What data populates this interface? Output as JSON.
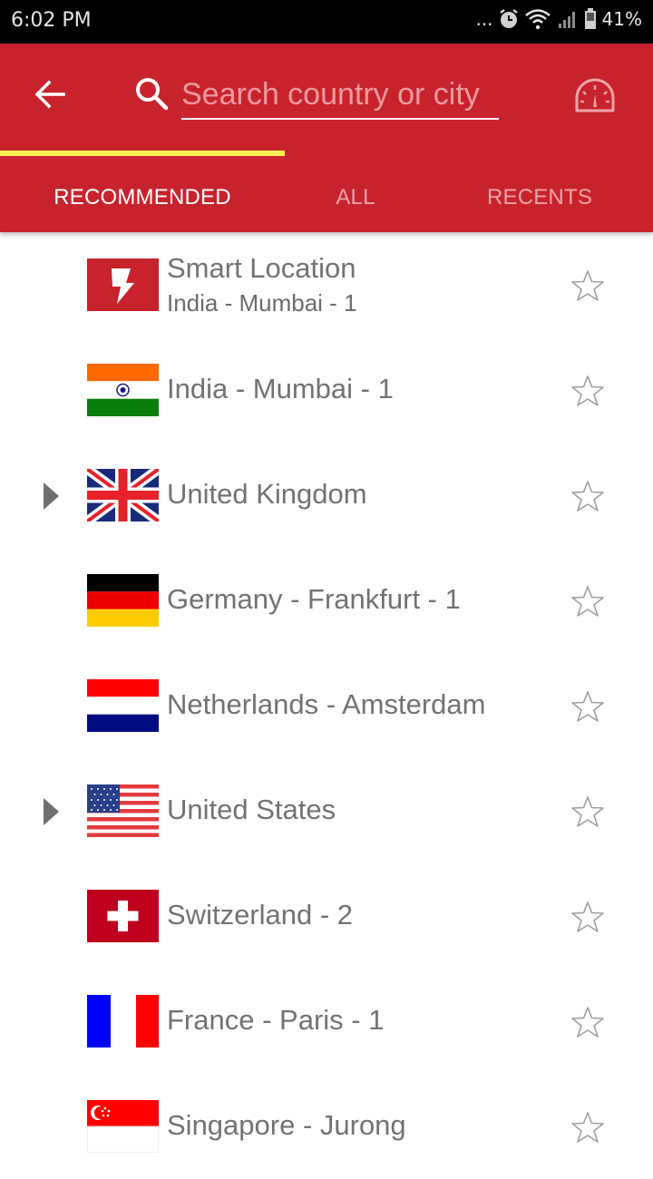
{
  "status_bar": {
    "time": "6:02 PM",
    "overflow": "...",
    "battery": "41%",
    "icons": [
      "alarm-icon",
      "wifi-icon",
      "signal-icon",
      "battery-icon"
    ]
  },
  "app_bar": {
    "back_icon": "arrow-left-icon",
    "search_icon": "search-icon",
    "search_value": "",
    "search_placeholder": "Search country or city",
    "speed_test_icon": "speedometer-icon",
    "background": "#c8232c",
    "tab_indicator_color": "#fff154"
  },
  "tabs": [
    {
      "label": "RECOMMENDED",
      "active": true
    },
    {
      "label": "ALL",
      "active": false
    },
    {
      "label": "RECENTS",
      "active": false
    }
  ],
  "locations": [
    {
      "name": "Smart Location",
      "subtitle": "India - Mumbai - 1",
      "flag": "smart-location",
      "expandable": false,
      "favorite": false
    },
    {
      "name": "India - Mumbai - 1",
      "flag": "india",
      "expandable": false,
      "favorite": false
    },
    {
      "name": "United Kingdom",
      "flag": "united-kingdom",
      "expandable": true,
      "favorite": false
    },
    {
      "name": "Germany - Frankfurt - 1",
      "flag": "germany",
      "expandable": false,
      "favorite": false
    },
    {
      "name": "Netherlands - Amsterdam",
      "flag": "netherlands",
      "expandable": false,
      "favorite": false
    },
    {
      "name": "United States",
      "flag": "united-states",
      "expandable": true,
      "favorite": false
    },
    {
      "name": "Switzerland - 2",
      "flag": "switzerland",
      "expandable": false,
      "favorite": false
    },
    {
      "name": "France - Paris - 1",
      "flag": "france",
      "expandable": false,
      "favorite": false
    },
    {
      "name": "Singapore - Jurong",
      "flag": "singapore",
      "expandable": false,
      "favorite": false
    }
  ]
}
